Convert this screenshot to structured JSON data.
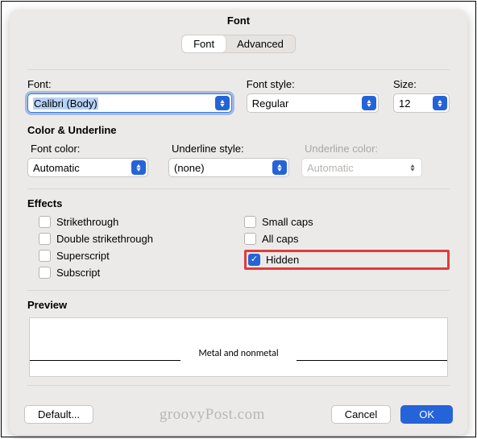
{
  "title": "Font",
  "tabs": {
    "font": "Font",
    "advanced": "Advanced"
  },
  "fontRow": {
    "fontLabel": "Font:",
    "fontValue": "Calibri (Body)",
    "styleLabel": "Font style:",
    "styleValue": "Regular",
    "sizeLabel": "Size:",
    "sizeValue": "12"
  },
  "colorSection": {
    "heading": "Color & Underline",
    "fontColorLabel": "Font color:",
    "fontColorValue": "Automatic",
    "underlineStyleLabel": "Underline style:",
    "underlineStyleValue": "(none)",
    "underlineColorLabel": "Underline color:",
    "underlineColorValue": "Automatic"
  },
  "effects": {
    "heading": "Effects",
    "strikethrough": "Strikethrough",
    "doubleStrike": "Double strikethrough",
    "superscript": "Superscript",
    "subscript": "Subscript",
    "smallCaps": "Small caps",
    "allCaps": "All caps",
    "hidden": "Hidden"
  },
  "preview": {
    "heading": "Preview",
    "text": "Metal and nonmetal"
  },
  "buttons": {
    "default": "Default...",
    "cancel": "Cancel",
    "ok": "OK"
  },
  "watermark": "groovyPost.com"
}
